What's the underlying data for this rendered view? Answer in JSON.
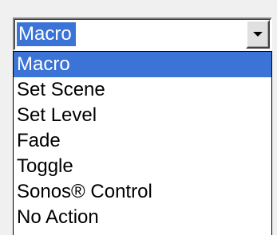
{
  "combo": {
    "value": "Macro",
    "arrow_icon": "dropdown-arrow-icon"
  },
  "dropdown": {
    "selected_index": 0,
    "items": [
      {
        "label": "Macro"
      },
      {
        "label": "Set Scene"
      },
      {
        "label": "Set Level"
      },
      {
        "label": "Fade"
      },
      {
        "label": "Toggle"
      },
      {
        "label": "Sonos® Control"
      },
      {
        "label": "No Action"
      }
    ]
  },
  "colors": {
    "selection": "#3b73d6",
    "window_bg": "#f0f0f0",
    "list_bg": "#ffffff"
  }
}
